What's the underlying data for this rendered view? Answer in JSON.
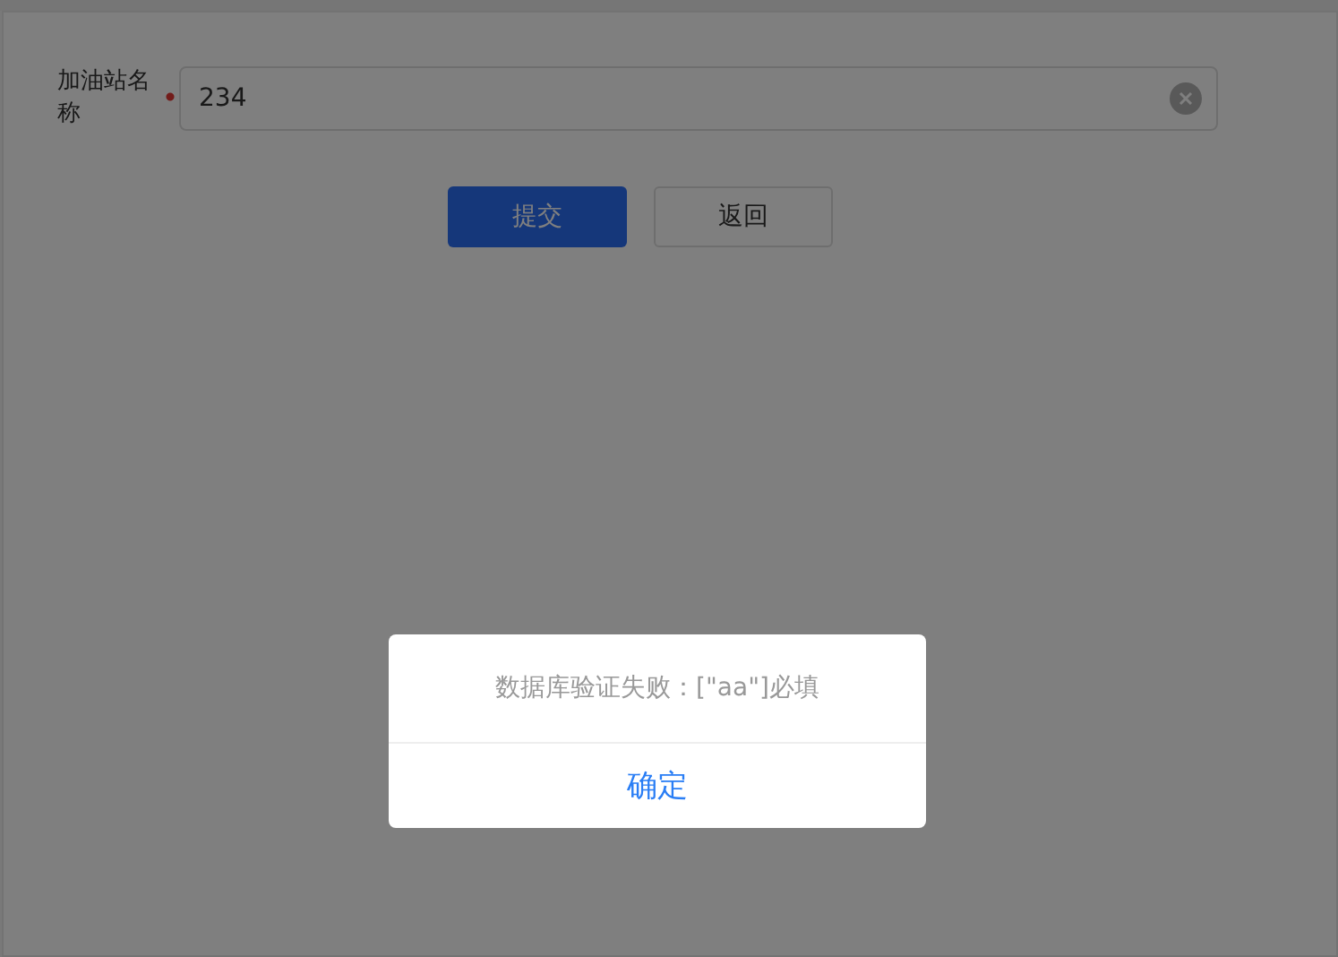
{
  "form": {
    "field": {
      "label": "加油站名称",
      "required": true,
      "value": "234"
    },
    "buttons": [
      {
        "label": "提交",
        "kind": "primary"
      },
      {
        "label": "返回",
        "kind": "default"
      }
    ]
  },
  "dialog": {
    "message": "数据库验证失败：[\"aa\"]必填",
    "button": "确定"
  }
}
